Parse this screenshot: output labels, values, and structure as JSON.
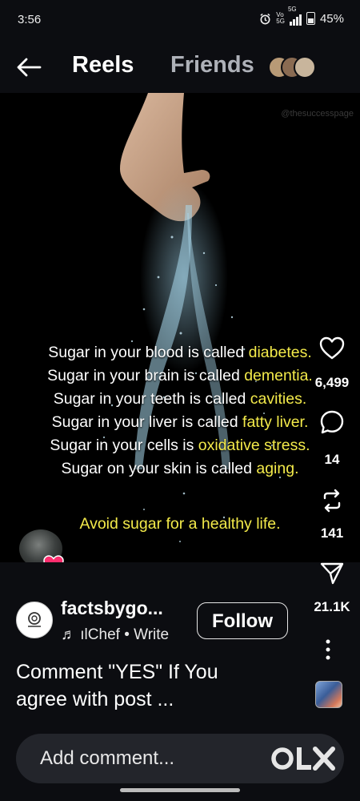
{
  "status_bar": {
    "time": "3:56",
    "network_top": "Vo",
    "network_bottom": "5G",
    "net_gen": "5G",
    "battery": "45%",
    "icons": [
      "alarm-icon",
      "signal-icon",
      "battery-icon"
    ]
  },
  "header": {
    "back_icon": "arrow-left-icon",
    "tabs": [
      {
        "label": "Reels",
        "active": true
      },
      {
        "label": "Friends",
        "active": false
      }
    ]
  },
  "video": {
    "watermark": "@thesuccesspage",
    "lines": [
      {
        "prefix": "Sugar in your blood is called ",
        "highlight": "diabetes",
        "suffix": "."
      },
      {
        "prefix": "Sugar in your brain is called ",
        "highlight": "dementia",
        "suffix": "."
      },
      {
        "prefix": "Sugar in your teeth is called ",
        "highlight": "cavities",
        "suffix": "."
      },
      {
        "prefix": "Sugar in your liver is called ",
        "highlight": "fatty liver",
        "suffix": "."
      },
      {
        "prefix": "Sugar in your cells is ",
        "highlight": "oxidative stress",
        "suffix": "."
      },
      {
        "prefix": "Sugar on your skin is called ",
        "highlight": "aging",
        "suffix": "."
      }
    ],
    "tagline": "Avoid sugar for a healthy life.",
    "highlight_color": "#f3ea4a"
  },
  "actions": {
    "like": {
      "icon": "heart-icon",
      "count": "6,499"
    },
    "comment": {
      "icon": "comment-icon",
      "count": "14"
    },
    "share": {
      "icon": "repost-icon",
      "count": "141"
    },
    "send": {
      "icon": "send-icon",
      "count": "21.1K"
    },
    "more": {
      "icon": "more-vertical-icon"
    }
  },
  "post": {
    "account_name": "factsbygo...",
    "music": "♬ ılChef • Write",
    "follow_label": "Follow",
    "caption_line1": "Comment \"YES\" If You",
    "caption_line2": "agree with post ..."
  },
  "comment": {
    "placeholder": "Add comment...",
    "logo_text": "OLX"
  }
}
